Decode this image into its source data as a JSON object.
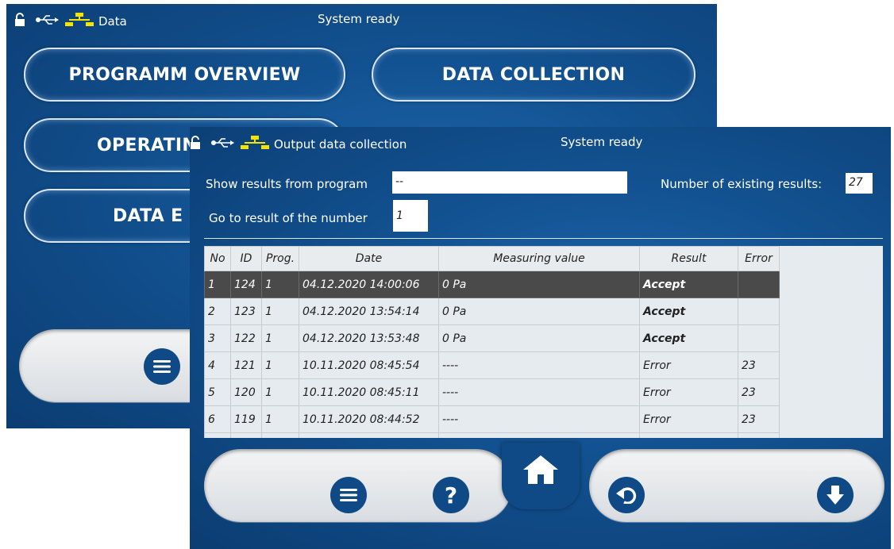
{
  "back_screen": {
    "statusbar": {
      "title": "Data",
      "status": "System ready"
    },
    "buttons": [
      {
        "label": "PROGRAMM OVERVIEW"
      },
      {
        "label": "DATA COLLECTION"
      },
      {
        "label": "OPERATIN"
      },
      {
        "label": "DATA E"
      }
    ]
  },
  "front_screen": {
    "statusbar": {
      "title": "Output data collection",
      "status": "System ready"
    },
    "show_results_label": "Show results from program",
    "show_results_value": "--",
    "existing_results_label": "Number of existing results:",
    "existing_results_value": "27",
    "goto_label": "Go to result of the number",
    "goto_value": "1",
    "table": {
      "columns": [
        "No",
        "ID",
        "Prog.",
        "Date",
        "Measuring value",
        "Result",
        "Error"
      ],
      "rows": [
        {
          "no": "1",
          "id": "124",
          "prog": "1",
          "date": "04.12.2020 14:00:06",
          "value": "0 Pa",
          "result": "Accept",
          "error": ""
        },
        {
          "no": "2",
          "id": "123",
          "prog": "1",
          "date": "04.12.2020 13:54:14",
          "value": "0 Pa",
          "result": "Accept",
          "error": ""
        },
        {
          "no": "3",
          "id": "122",
          "prog": "1",
          "date": "04.12.2020 13:53:48",
          "value": "0 Pa",
          "result": "Accept",
          "error": ""
        },
        {
          "no": "4",
          "id": "121",
          "prog": "1",
          "date": "10.11.2020 08:45:54",
          "value": "----",
          "result": "Error",
          "error": "23"
        },
        {
          "no": "5",
          "id": "120",
          "prog": "1",
          "date": "10.11.2020 08:45:11",
          "value": "----",
          "result": "Error",
          "error": "23"
        },
        {
          "no": "6",
          "id": "119",
          "prog": "1",
          "date": "10.11.2020 08:44:52",
          "value": "----",
          "result": "Error",
          "error": "23"
        }
      ]
    },
    "toolbar": [
      "menu-icon",
      "help-icon",
      "home-icon",
      "back-icon",
      "download-icon"
    ]
  },
  "colors": {
    "panel_blue": "#12508f",
    "button_blue": "#0f4a86",
    "yellow_icon": "#f5e400",
    "selected_row": "#4a4a4a"
  }
}
